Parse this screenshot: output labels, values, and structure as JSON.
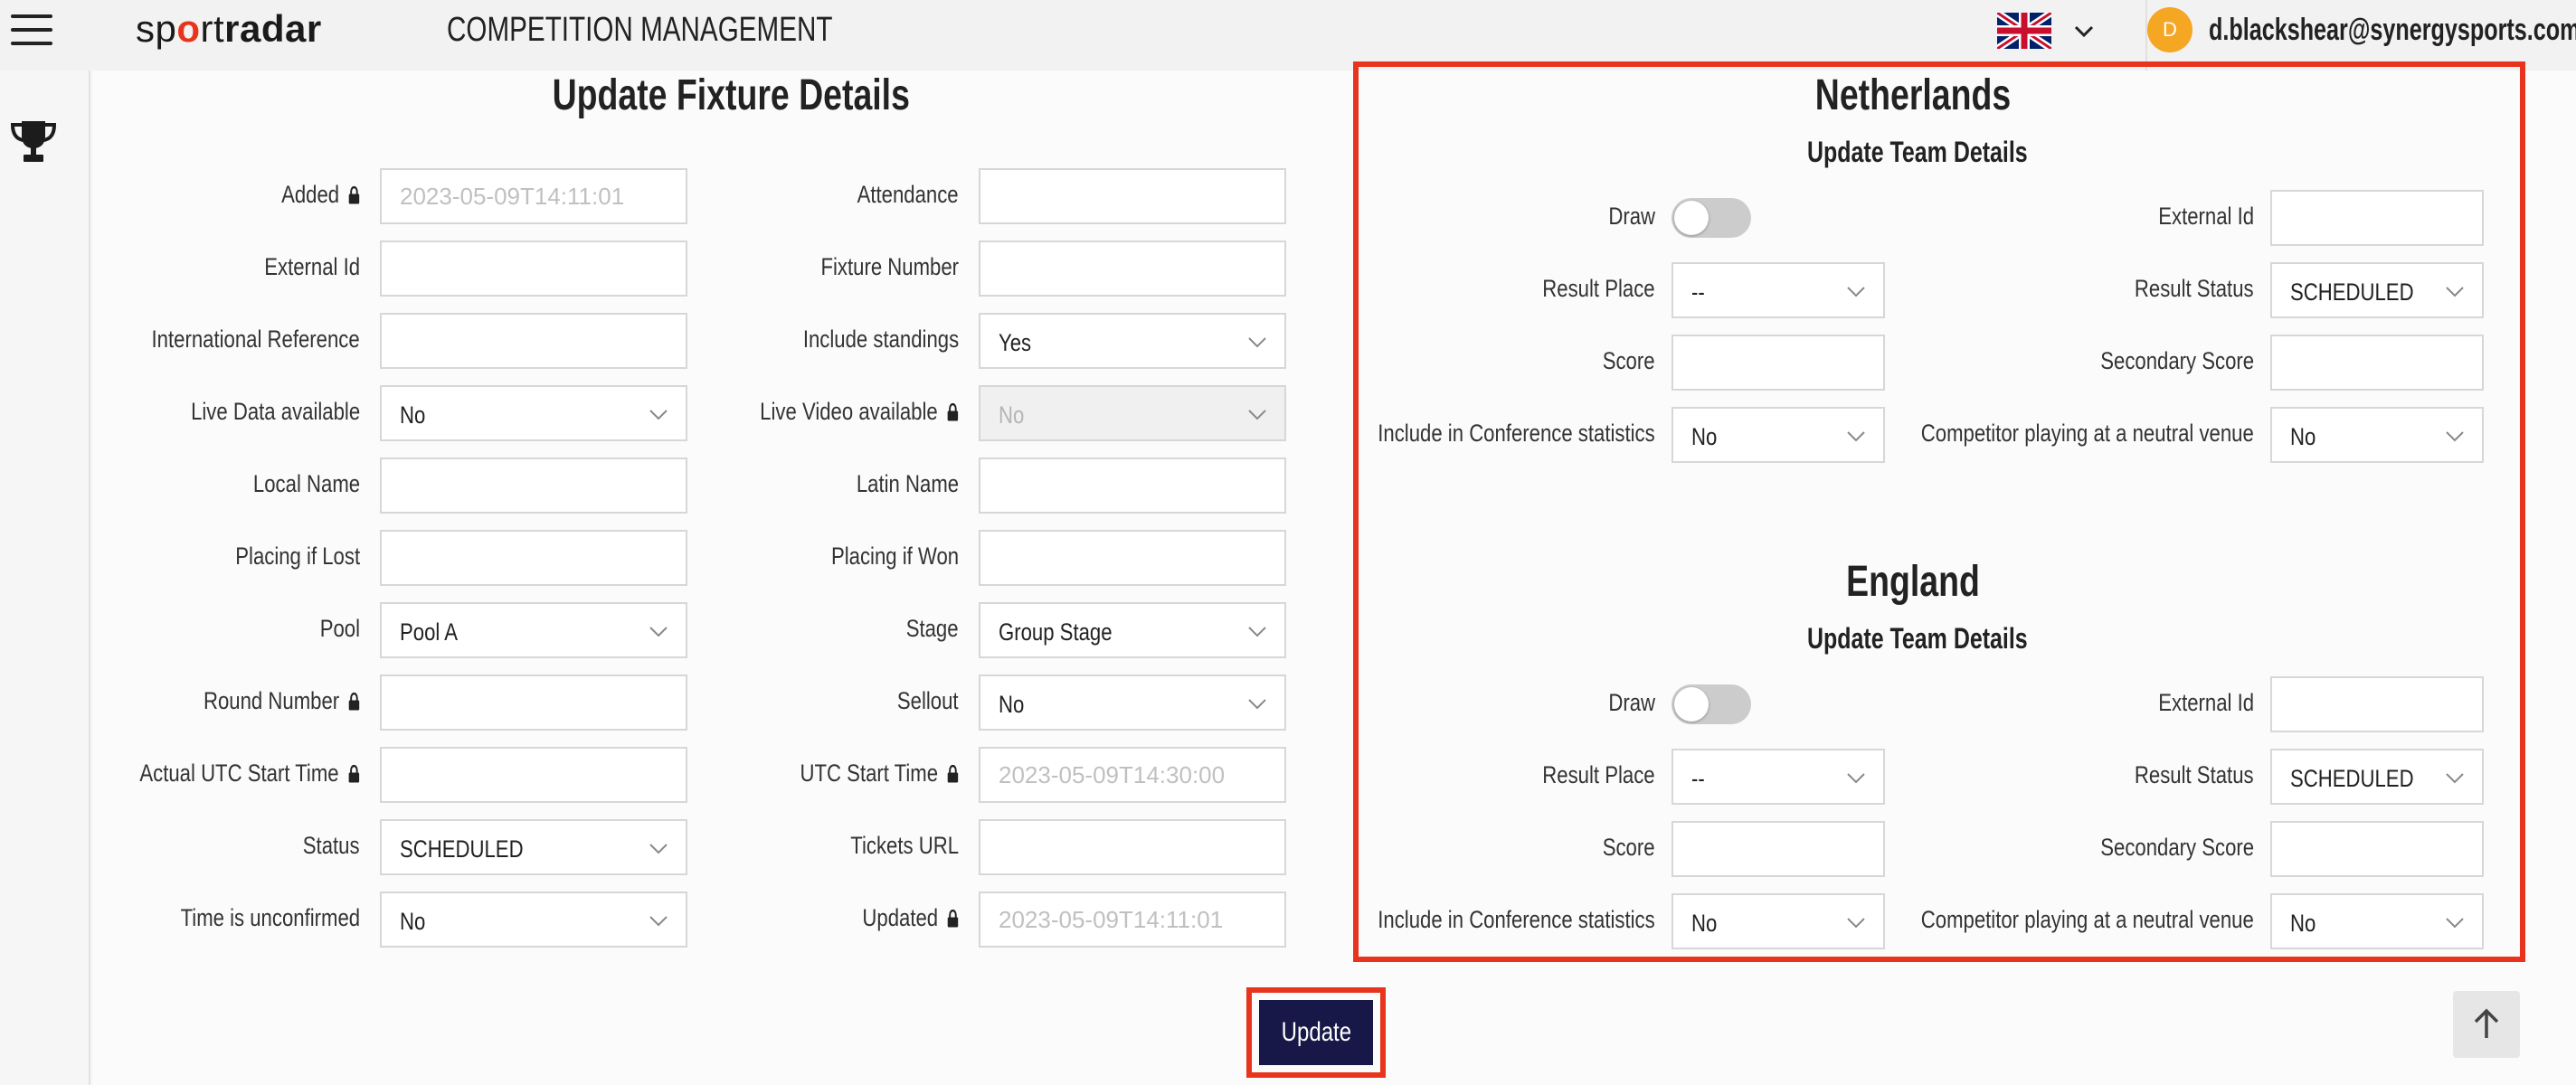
{
  "header": {
    "logo_parts": [
      "sp",
      "o",
      "rt",
      "radar"
    ],
    "app_title": "COMPETITION MANAGEMENT",
    "avatar_initial": "D",
    "user_email": "d.blackshear@synergysports.com"
  },
  "fixture": {
    "title": "Update Fixture Details",
    "left": [
      {
        "label": "Added",
        "type": "input",
        "locked": true,
        "placeholder": "2023-05-09T14:11:01",
        "value": ""
      },
      {
        "label": "External Id",
        "type": "input",
        "locked": false,
        "placeholder": "",
        "value": ""
      },
      {
        "label": "International Reference",
        "type": "input",
        "locked": false,
        "placeholder": "",
        "value": ""
      },
      {
        "label": "Live Data available",
        "type": "select",
        "locked": false,
        "value": "No"
      },
      {
        "label": "Local Name",
        "type": "input",
        "locked": false,
        "placeholder": "",
        "value": ""
      },
      {
        "label": "Placing if Lost",
        "type": "input",
        "locked": false,
        "placeholder": "",
        "value": ""
      },
      {
        "label": "Pool",
        "type": "select",
        "locked": false,
        "value": "Pool A"
      },
      {
        "label": "Round Number",
        "type": "input",
        "locked": true,
        "placeholder": "",
        "value": ""
      },
      {
        "label": "Actual UTC Start Time",
        "type": "input",
        "locked": true,
        "placeholder": "",
        "value": ""
      },
      {
        "label": "Status",
        "type": "select",
        "locked": false,
        "value": "SCHEDULED"
      },
      {
        "label": "Time is unconfirmed",
        "type": "select",
        "locked": false,
        "value": "No"
      }
    ],
    "right": [
      {
        "label": "Attendance",
        "type": "input",
        "locked": false,
        "placeholder": "",
        "value": ""
      },
      {
        "label": "Fixture Number",
        "type": "input",
        "locked": false,
        "placeholder": "",
        "value": ""
      },
      {
        "label": "Include standings",
        "type": "select",
        "locked": false,
        "value": "Yes"
      },
      {
        "label": "Live Video available",
        "type": "select",
        "locked": true,
        "disabled": true,
        "value": "No"
      },
      {
        "label": "Latin Name",
        "type": "input",
        "locked": false,
        "placeholder": "",
        "value": ""
      },
      {
        "label": "Placing if Won",
        "type": "input",
        "locked": false,
        "placeholder": "",
        "value": ""
      },
      {
        "label": "Stage",
        "type": "select",
        "locked": false,
        "value": "Group Stage"
      },
      {
        "label": "Sellout",
        "type": "select",
        "locked": false,
        "value": "No"
      },
      {
        "label": "UTC Start Time",
        "type": "input",
        "locked": true,
        "placeholder": "2023-05-09T14:30:00",
        "value": ""
      },
      {
        "label": "Tickets URL",
        "type": "input",
        "locked": false,
        "placeholder": "",
        "value": ""
      },
      {
        "label": "Updated",
        "type": "input",
        "locked": true,
        "placeholder": "2023-05-09T14:11:01",
        "value": ""
      }
    ]
  },
  "teams": [
    {
      "name": "Netherlands",
      "subtitle": "Update Team Details",
      "left": [
        {
          "label": "Draw",
          "type": "toggle",
          "value": "off"
        },
        {
          "label": "Result Place",
          "type": "select",
          "value": "--"
        },
        {
          "label": "Score",
          "type": "input",
          "value": ""
        },
        {
          "label": "Include in Conference statistics",
          "type": "select",
          "value": "No"
        }
      ],
      "right": [
        {
          "label": "External Id",
          "type": "input",
          "value": ""
        },
        {
          "label": "Result Status",
          "type": "select",
          "value": "SCHEDULED"
        },
        {
          "label": "Secondary Score",
          "type": "input",
          "value": ""
        },
        {
          "label": "Competitor playing at a neutral venue",
          "type": "select",
          "value": "No"
        }
      ]
    },
    {
      "name": "England",
      "subtitle": "Update Team Details",
      "left": [
        {
          "label": "Draw",
          "type": "toggle",
          "value": "off"
        },
        {
          "label": "Result Place",
          "type": "select",
          "value": "--"
        },
        {
          "label": "Score",
          "type": "input",
          "value": ""
        },
        {
          "label": "Include in Conference statistics",
          "type": "select",
          "value": "No"
        }
      ],
      "right": [
        {
          "label": "External Id",
          "type": "input",
          "value": ""
        },
        {
          "label": "Result Status",
          "type": "select",
          "value": "SCHEDULED"
        },
        {
          "label": "Secondary Score",
          "type": "input",
          "value": ""
        },
        {
          "label": "Competitor playing at a neutral venue",
          "type": "select",
          "value": "No"
        }
      ]
    }
  ],
  "actions": {
    "update_label": "Update"
  },
  "colors": {
    "accent_red": "#e8341c",
    "button_navy": "#181848",
    "avatar_orange": "#f5a623"
  }
}
